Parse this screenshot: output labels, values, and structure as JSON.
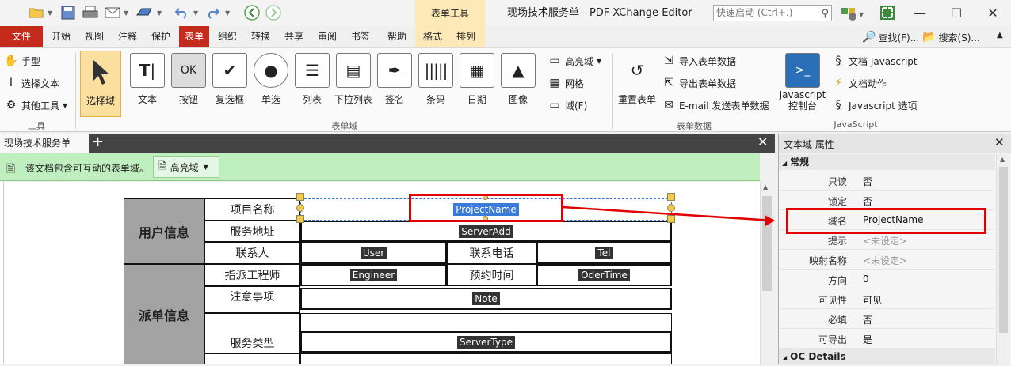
{
  "window": {
    "title": "现场技术服务单 - PDF-XChange Editor",
    "context_tab_head": "表单工具",
    "quick_launch_placeholder": "快速启动 (Ctrl+.)"
  },
  "menu_tabs": [
    "文件",
    "开始",
    "视图",
    "注释",
    "保护",
    "表单",
    "组织",
    "转换",
    "共享",
    "审阅",
    "书签",
    "帮助",
    "格式",
    "排列"
  ],
  "menu_right": {
    "find": "查找(F)...",
    "search": "搜索(S)..."
  },
  "ribbon": {
    "tools": {
      "hand": "手型",
      "select_text": "选择文本",
      "other_tools": "其他工具",
      "group": "工具"
    },
    "fields": {
      "select_field": "选择域",
      "text": "文本",
      "button": "按钮",
      "button_icon_text": "OK",
      "checkbox": "复选框",
      "radio": "单选",
      "list": "列表",
      "dropdown": "下拉列表",
      "signature": "签名",
      "barcode": "条码",
      "date": "日期",
      "image": "图像",
      "highlight": "高亮域",
      "grid": "网格",
      "field": "域(F)",
      "group": "表单域"
    },
    "form_data": {
      "reset": "重置表单",
      "import": "导入表单数据",
      "export": "导出表单数据",
      "email": "E-mail 发送表单数据",
      "group": "表单数据"
    },
    "javascript": {
      "console": "Javascript 控制台",
      "doc_js": "文档 Javascript",
      "doc_actions": "文档动作",
      "js_options": "Javascript 选项",
      "group": "JavaScript"
    }
  },
  "doc": {
    "tab_label": "现场技术服务单",
    "info_text": "该文档包含可互动的表单域。",
    "highlight_button": "高亮域",
    "form": {
      "user_info": "用户信息",
      "dispatch_info": "派单信息",
      "project_name": "项目名称",
      "service_address": "服务地址",
      "contact": "联系人",
      "contact_phone": "联系电话",
      "engineer": "指派工程师",
      "appointment": "预约时间",
      "notes": "注意事项",
      "service_type": "服务类型"
    },
    "fields": {
      "project_name": "ProjectName",
      "server_add": "ServerAdd",
      "user": "User",
      "tel": "Tel",
      "engineer": "Engineer",
      "oder_time": "OderTime",
      "note": "Note",
      "server_type": "ServerType"
    }
  },
  "properties": {
    "title": "文本域 属性",
    "section_general": "常规",
    "section_oc": "OC Details",
    "rows": [
      {
        "key": "只读",
        "value": "否"
      },
      {
        "key": "锁定",
        "value": "否"
      },
      {
        "key": "域名",
        "value": "ProjectName"
      },
      {
        "key": "提示",
        "value": "<未设定>"
      },
      {
        "key": "映射名称",
        "value": "<未设定>"
      },
      {
        "key": "方向",
        "value": "0"
      },
      {
        "key": "可见性",
        "value": "可见"
      },
      {
        "key": "必填",
        "value": "否"
      },
      {
        "key": "可导出",
        "value": "是"
      }
    ]
  },
  "colors": {
    "accent": "#c42b1c",
    "annotation_red": "#e00000",
    "info_green": "#bfeebf",
    "context_tab": "#fde9b7"
  }
}
